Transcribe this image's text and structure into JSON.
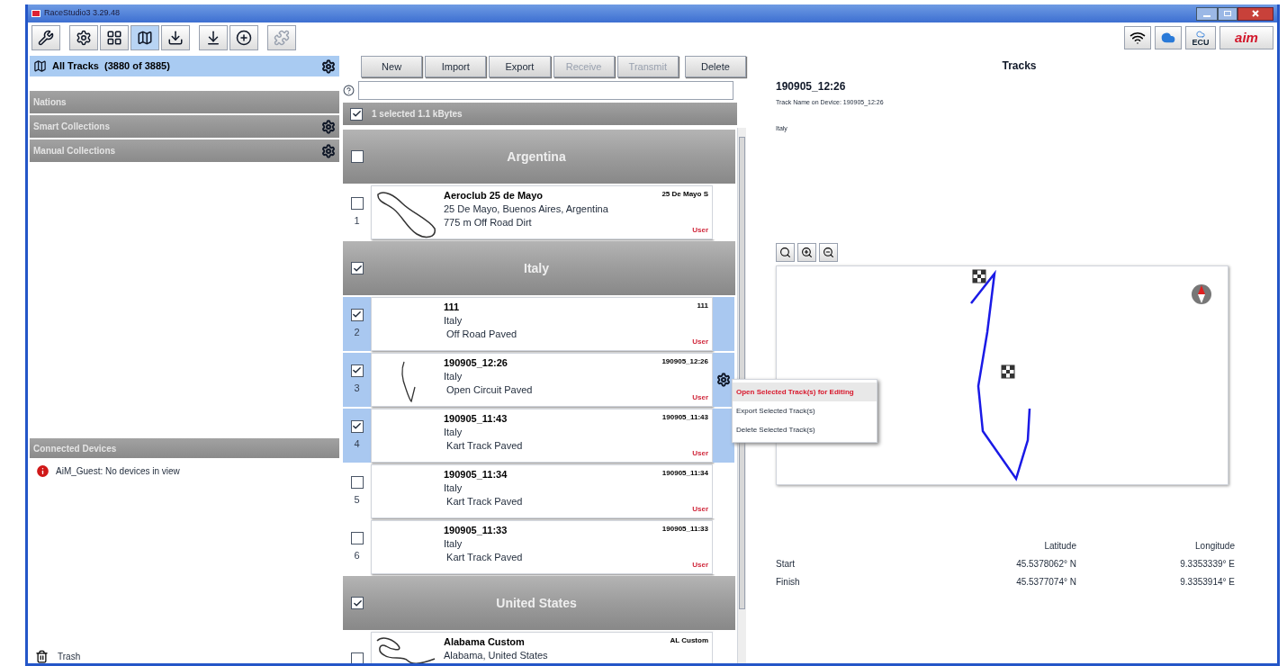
{
  "window": {
    "title": "RaceStudio3 3.29.48"
  },
  "toolbar": [
    {
      "kind": "tools",
      "selected": false,
      "disabled": false
    },
    {
      "kind": "settings",
      "selected": false,
      "disabled": false
    },
    {
      "kind": "grid",
      "selected": false,
      "disabled": false
    },
    {
      "kind": "tracks",
      "selected": true,
      "disabled": false
    },
    {
      "kind": "download",
      "selected": false,
      "disabled": false
    },
    {
      "kind": "level",
      "selected": false,
      "disabled": false
    },
    {
      "kind": "add",
      "selected": false,
      "disabled": false
    },
    {
      "kind": "puzzle",
      "selected": false,
      "disabled": true
    }
  ],
  "status_icons": [
    {
      "kind": "wifi"
    },
    {
      "kind": "cloud"
    },
    {
      "kind": "ecu",
      "label": "ECU"
    },
    {
      "kind": "logo",
      "label": "aim"
    }
  ],
  "sidebar": {
    "all_tracks": {
      "label": "All Tracks  (3880 of 3885)",
      "selected": true
    },
    "sections": [
      {
        "label": "Nations",
        "gear": false
      },
      {
        "label": "Smart Collections",
        "gear": true
      },
      {
        "label": "Manual Collections",
        "gear": true
      }
    ],
    "devices_header": "Connected Devices",
    "device_message": "AiM_Guest: No devices in view",
    "trash": "Trash"
  },
  "actions": [
    {
      "label": "New",
      "disabled": false
    },
    {
      "label": "Import",
      "disabled": false
    },
    {
      "label": "Export",
      "disabled": false
    },
    {
      "label": "Receive",
      "disabled": true
    },
    {
      "label": "Transmit",
      "disabled": true
    },
    {
      "label": "Delete",
      "disabled": false
    }
  ],
  "selection_bar": {
    "checked": true,
    "label": "1 selected 1.1 kBytes"
  },
  "groups": [
    {
      "name": "Argentina",
      "checked": false,
      "tracks": [
        {
          "number": "1",
          "name": "Aeroclub 25 de Mayo",
          "short": "25 De Mayo S",
          "place": "25 De Mayo, Buenos Aires, Argentina",
          "type": "775 m Off Road Dirt",
          "tag": "User",
          "checked": false,
          "selected": false,
          "kind": "loop"
        }
      ]
    },
    {
      "name": "Italy",
      "checked": true,
      "tracks": [
        {
          "number": "2",
          "name": "111",
          "short": "111",
          "place": "Italy",
          "type": " Off Road Paved",
          "tag": "User",
          "checked": true,
          "selected": true,
          "kind": "plain"
        },
        {
          "number": "3",
          "name": "190905_12:26",
          "short": "190905_12:26",
          "place": "Italy",
          "type": " Open Circuit Paved",
          "tag": "User",
          "checked": true,
          "selected": true,
          "kind": "hook",
          "menu": [
            {
              "label": "Open Selected Track(s) for Editing",
              "selected": true
            },
            {
              "label": "Export Selected Track(s)",
              "selected": false
            },
            {
              "label": "Delete Selected Track(s)",
              "selected": false
            }
          ]
        },
        {
          "number": "4",
          "name": "190905_11:43",
          "short": "190905_11:43",
          "place": "Italy",
          "type": " Kart Track Paved",
          "tag": "User",
          "checked": true,
          "selected": true,
          "kind": "plain"
        },
        {
          "number": "5",
          "name": "190905_11:34",
          "short": "190905_11:34",
          "place": "Italy",
          "type": " Kart Track Paved",
          "tag": "User",
          "checked": false,
          "selected": false,
          "kind": "plain"
        },
        {
          "number": "6",
          "name": "190905_11:33",
          "short": "190905_11:33",
          "place": "Italy",
          "type": " Kart Track Paved",
          "tag": "User",
          "checked": false,
          "selected": false,
          "kind": "plain"
        }
      ]
    },
    {
      "name": "United States",
      "checked": true,
      "tracks": [
        {
          "name": "Alabama Custom",
          "short": "AL Custom",
          "place": "Alabama, United States",
          "checked": false,
          "selected": false,
          "kind": "snake"
        }
      ]
    }
  ],
  "detail": {
    "heading": "Tracks",
    "name": "190905_12:26",
    "device_name": "Track Name on Device: 190905_12:26",
    "nation": "Italy",
    "coords": {
      "columns": [
        "Latitude",
        "Longitude"
      ],
      "rows": [
        {
          "label": "Start",
          "lat": "45.5378062° N",
          "lon": "9.3353339° E"
        },
        {
          "label": "Finish",
          "lat": "45.5377074° N",
          "lon": "9.3353914° E"
        }
      ]
    }
  }
}
